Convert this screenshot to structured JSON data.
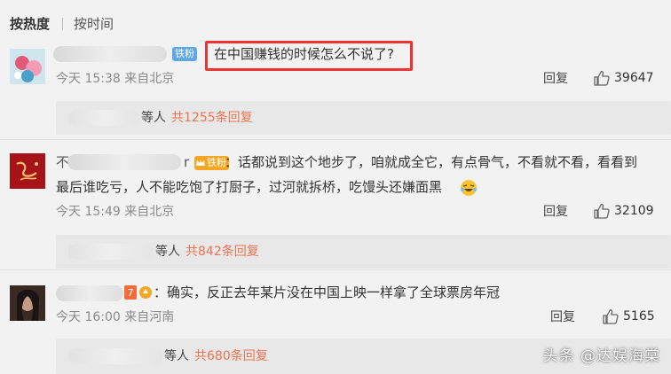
{
  "tabs": {
    "hot": "按热度",
    "time": "按时间"
  },
  "comments": [
    {
      "badge": "铁粉",
      "text": "在中国赚钱的时候怎么不说了?",
      "time": "今天 15:38 来自北京",
      "reply_label": "回复",
      "likes": "39647",
      "replies_mid": "等人",
      "replies_count": "共1255条回复"
    },
    {
      "name_prefix": "不",
      "name_suffix": "r",
      "badge": "铁粉",
      "text_line1": "：话都说到这个地步了，咱就成全它，有点骨气，不看就不看，看看到",
      "text_line2": "最后谁吃亏，人不能吃饱了打厨子，过河就拆桥，吃馒头还嫌面黑",
      "emoji": "laughing-crying-emoji",
      "time": "今天 15:49 来自北京",
      "reply_label": "回复",
      "likes": "32109",
      "replies_mid": "等人",
      "replies_count": "共842条回复"
    },
    {
      "text": "：确实，反正去年某片没在中国上映一样拿了全球票房年冠",
      "time": "今天 16:00 来自河南",
      "reply_label": "回复",
      "likes": "5165",
      "replies_mid": "等人",
      "replies_count": "共680条回复"
    }
  ],
  "watermark": "头条 @达娱海棠",
  "colors": {
    "accent": "#eb7350",
    "highlight": "#e33333",
    "badge": "#f5a623"
  }
}
